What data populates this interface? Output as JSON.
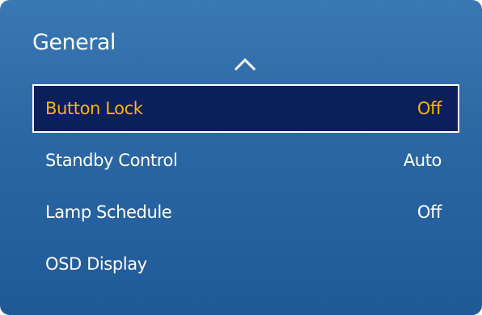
{
  "panel": {
    "title": "General",
    "scroll_indicator_icon": "chevron-up-icon"
  },
  "menu": {
    "selected_index": 0,
    "items": [
      {
        "label": "Button Lock",
        "value": "Off"
      },
      {
        "label": "Standby Control",
        "value": "Auto"
      },
      {
        "label": "Lamp Schedule",
        "value": "Off"
      },
      {
        "label": "OSD Display",
        "value": ""
      }
    ]
  },
  "colors": {
    "panel_top": "#3a78b4",
    "panel_bottom": "#1f5a98",
    "selected_background": "#0a1f5c",
    "selected_text": "#ffb400",
    "text": "#ffffff"
  }
}
